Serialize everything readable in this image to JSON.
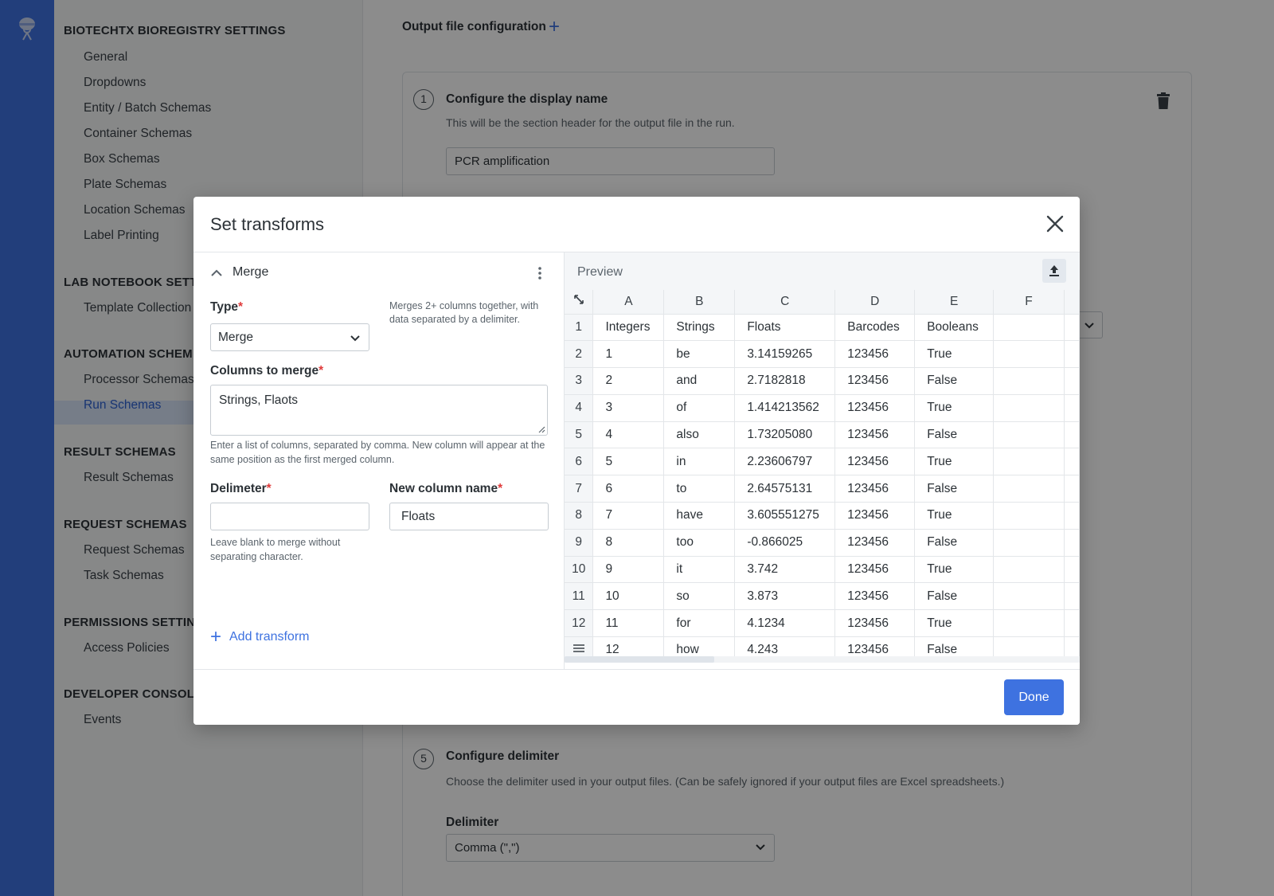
{
  "nav": {
    "sections": [
      {
        "title": "BIOTECHTX BIOREGISTRY SETTINGS",
        "items": [
          "General",
          "Dropdowns",
          "Entity / Batch Schemas",
          "Container Schemas",
          "Box Schemas",
          "Plate Schemas",
          "Location Schemas",
          "Label Printing"
        ]
      },
      {
        "title": "LAB NOTEBOOK SETT",
        "items": [
          "Template Collection"
        ]
      },
      {
        "title": "AUTOMATION SCHEM",
        "items": [
          "Processor Schemas",
          "Run Schemas"
        ]
      },
      {
        "title": "RESULT SCHEMAS",
        "items": [
          "Result Schemas"
        ]
      },
      {
        "title": "REQUEST SCHEMAS",
        "items": [
          "Request Schemas",
          "Task Schemas"
        ]
      },
      {
        "title": "PERMISSIONS SETTIN",
        "items": [
          "Access Policies"
        ]
      },
      {
        "title": "DEVELOPER CONSOL",
        "items": [
          "Events"
        ]
      }
    ],
    "active_item": "Run Schemas",
    "active_color": "#2d62d2"
  },
  "main": {
    "title": "Output file configuration",
    "step1": {
      "number": "1",
      "title": "Configure the display name",
      "description": "This will be the section header for the output file in the run.",
      "value": "PCR amplification"
    },
    "step5": {
      "number": "5",
      "title": "Configure delimiter",
      "description": "Choose the delimiter used in your output files. (Can be safely ignored if your output files are Excel spreadsheets.)",
      "delimiter_label": "Delimiter",
      "delimiter_value": "Comma (\",\")"
    }
  },
  "modal": {
    "title": "Set transforms",
    "transform": {
      "name": "Merge",
      "type_label": "Type",
      "type_value": "Merge",
      "type_hint": "Merges 2+ columns together, with data separated by a delimiter.",
      "columns_label": "Columns to merge",
      "columns_value": "Strings, Flaots",
      "columns_help": "Enter a list of columns, separated by comma. New column will appear at the same position as the first merged column.",
      "delimiter_label": "Delimeter",
      "delimiter_value": "",
      "delimiter_help": "Leave blank to merge without separating character.",
      "new_column_label": "New column name",
      "new_column_value": "Floats"
    },
    "add_transform": "Add transform",
    "done": "Done"
  },
  "preview": {
    "title": "Preview",
    "columns": [
      "A",
      "B",
      "C",
      "D",
      "E",
      "F"
    ],
    "row_numbers": [
      "1",
      "2",
      "3",
      "4",
      "5",
      "6",
      "7",
      "8",
      "9",
      "10",
      "11",
      "12"
    ],
    "rows": [
      [
        "Integers",
        "Strings",
        "Floats",
        "Barcodes",
        "Booleans",
        ""
      ],
      [
        "1",
        "be",
        "3.14159265",
        "123456",
        "True",
        ""
      ],
      [
        "2",
        "and",
        "2.7182818",
        "123456",
        "False",
        ""
      ],
      [
        "3",
        "of",
        "1.414213562",
        "123456",
        "True",
        ""
      ],
      [
        "4",
        "also",
        "1.73205080",
        "123456",
        "False",
        ""
      ],
      [
        "5",
        "in",
        "2.23606797",
        "123456",
        "True",
        ""
      ],
      [
        "6",
        "to",
        "2.64575131",
        "123456",
        "False",
        ""
      ],
      [
        "7",
        "have",
        "3.605551275",
        "123456",
        "True",
        ""
      ],
      [
        "8",
        "too",
        "-0.866025",
        "123456",
        "False",
        ""
      ],
      [
        "9",
        "it",
        "3.742",
        "123456",
        "True",
        ""
      ],
      [
        "10",
        "so",
        "3.873",
        "123456",
        "False",
        ""
      ],
      [
        "11",
        "for",
        "4.1234",
        "123456",
        "True",
        ""
      ],
      [
        "12",
        "how",
        "4.243",
        "123456",
        "False",
        ""
      ]
    ]
  },
  "colors": {
    "accent": "#3e72e0",
    "required": "#e03c3c"
  }
}
